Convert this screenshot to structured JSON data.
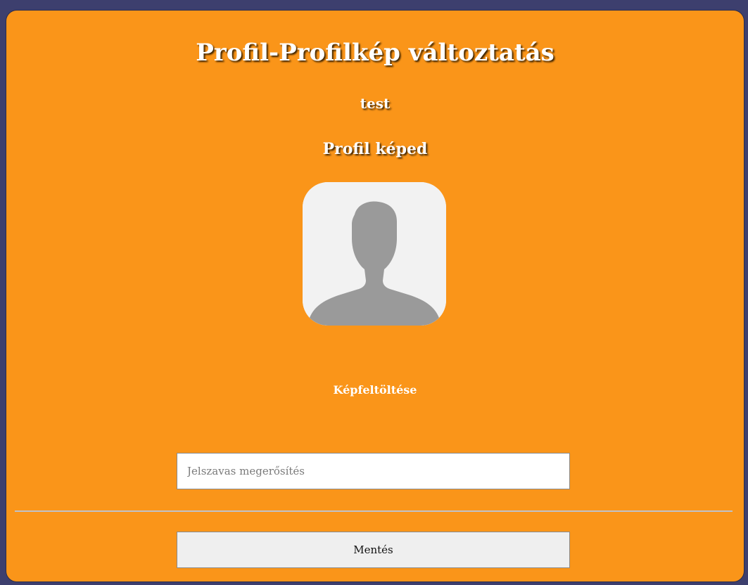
{
  "page": {
    "title": "Profil-Profilkép változtatás",
    "username": "test",
    "avatar_heading": "Profil képed",
    "upload_label": "Képfeltöltése",
    "password_placeholder": "Jelszavas megerősítés",
    "save_label": "Mentés"
  },
  "icons": {
    "avatar": "default-user-silhouette-icon"
  },
  "colors": {
    "background": "#3d3f6e",
    "card": "#fa9519",
    "text": "#ffffff",
    "avatar_bg": "#f2f2f2",
    "silhouette": "#9a9a9a"
  }
}
